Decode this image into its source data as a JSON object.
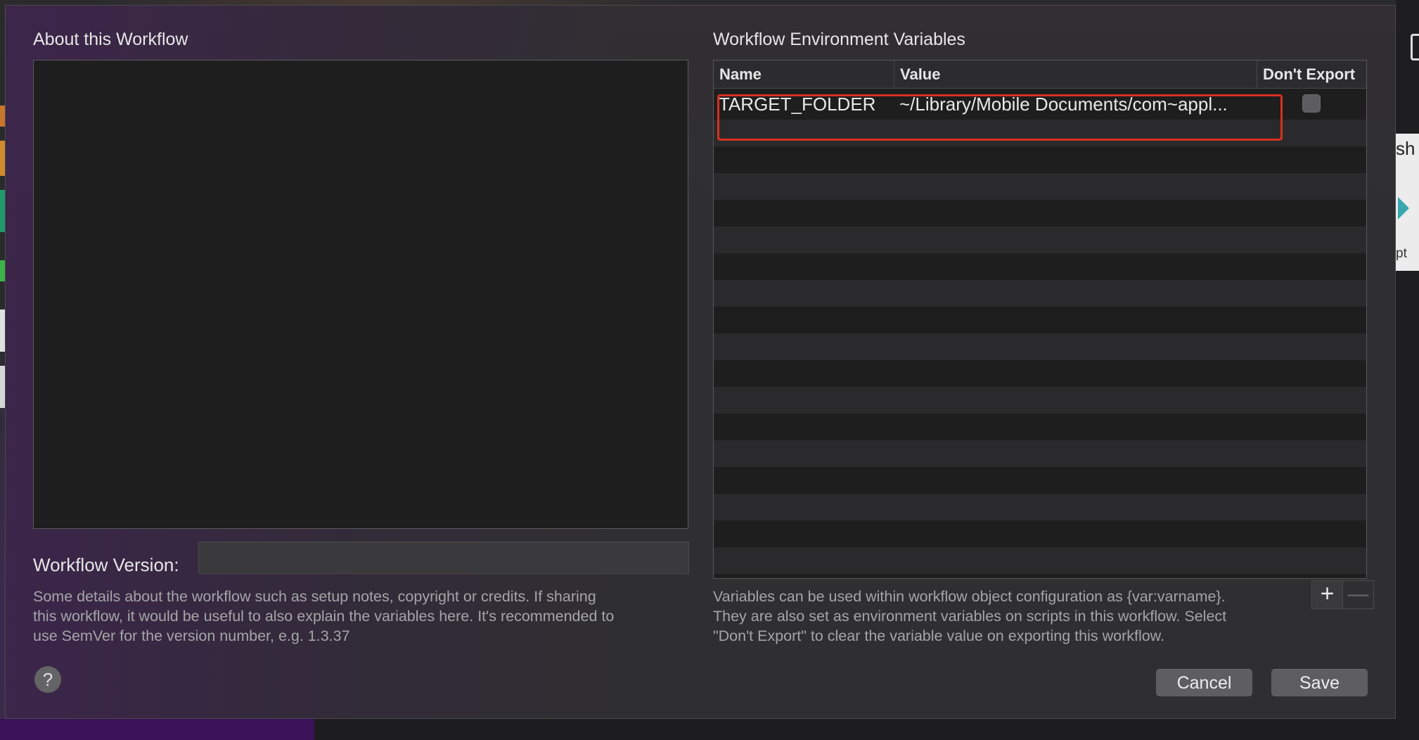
{
  "about": {
    "title": "About this Workflow",
    "version_label": "Workflow Version:",
    "version_value": "",
    "help_lines": [
      "Some details about the workflow such as setup notes, copyright or credits. If sharing",
      "this workflow, it would be useful to also explain the variables here. It's recommended to",
      "use SemVer for the version number, e.g. 1.3.37"
    ],
    "help_button": "?"
  },
  "env": {
    "title": "Workflow Environment Variables",
    "columns": {
      "name": "Name",
      "value": "Value",
      "dont_export": "Don't Export"
    },
    "rows": [
      {
        "name": "TARGET_FOLDER",
        "value": "~/Library/Mobile Documents/com~appl...",
        "dont_export": false
      }
    ],
    "help_lines": [
      "Variables can be used within workflow object configuration as {var:varname}.",
      "They are also set as environment variables on scripts in this workflow. Select",
      "\"Don't Export\" to clear the variable value on exporting this workflow."
    ],
    "add_label": "+",
    "remove_label": "—"
  },
  "buttons": {
    "cancel": "Cancel",
    "save": "Save"
  },
  "background": {
    "partial_text_1": "sh",
    "partial_text_2": "pt"
  },
  "colors": {
    "highlight": "#d6311f",
    "sheet": "#2f2f31"
  }
}
